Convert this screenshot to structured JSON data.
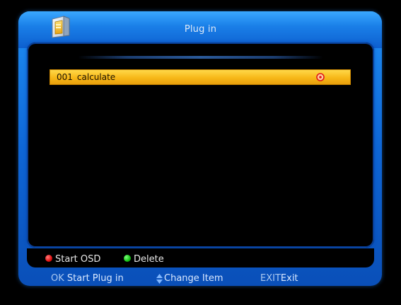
{
  "header": {
    "title": "Plug in"
  },
  "list": {
    "items": [
      {
        "number": "001",
        "name": "calculate",
        "selected": true
      }
    ]
  },
  "hints": {
    "red_label": "Start OSD",
    "green_label": "Delete"
  },
  "footer": {
    "ok_key": "OK",
    "ok_label": "Start Plug in",
    "nav_label": "Change Item",
    "exit_key": "EXIT",
    "exit_label": "Exit"
  },
  "colors": {
    "frame_blue": "#1478e6",
    "selection_yellow": "#f7b718",
    "red_key": "#e01010",
    "green_key": "#12c012"
  },
  "icons": {
    "app": "plugin-folder-icon",
    "row_marker": "red-circle-marker-icon",
    "nav": "up-down-arrow-icon"
  }
}
